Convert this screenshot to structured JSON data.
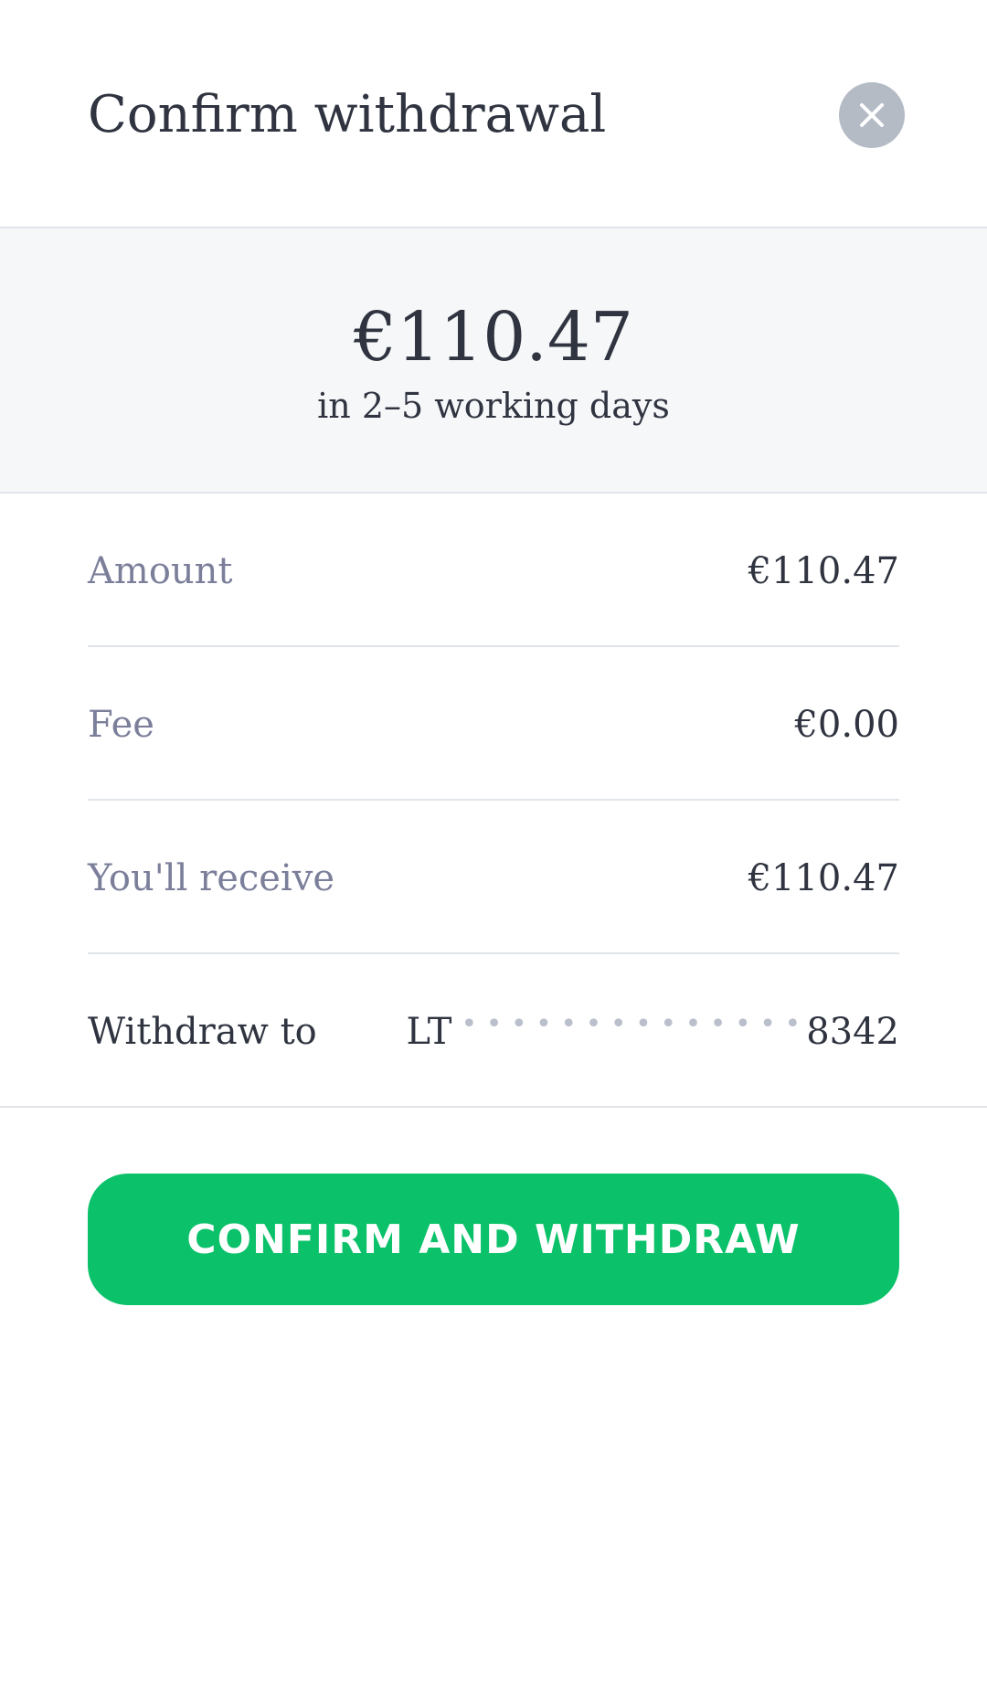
{
  "header": {
    "title": "Confirm withdrawal",
    "close_icon": "close-icon"
  },
  "summary": {
    "amount": "€110.47",
    "timeline": "in 2–5 working days"
  },
  "details": {
    "amount_label": "Amount",
    "amount_value": "€110.47",
    "fee_label": "Fee",
    "fee_value": "€0.00",
    "receive_label": "You'll receive",
    "receive_value": "€110.47",
    "withdraw_to_label": "Withdraw to",
    "account_prefix": "LT",
    "account_mask": "• • • • • • • • • • • • • •",
    "account_suffix": "8342"
  },
  "actions": {
    "confirm_label": "CONFIRM AND WITHDRAW"
  },
  "colors": {
    "accent": "#0bc16a",
    "close_button_bg": "#b4bbc5",
    "summary_bg": "#f6f7f9",
    "muted_label": "#7b7f9a",
    "text": "#2f3440"
  }
}
